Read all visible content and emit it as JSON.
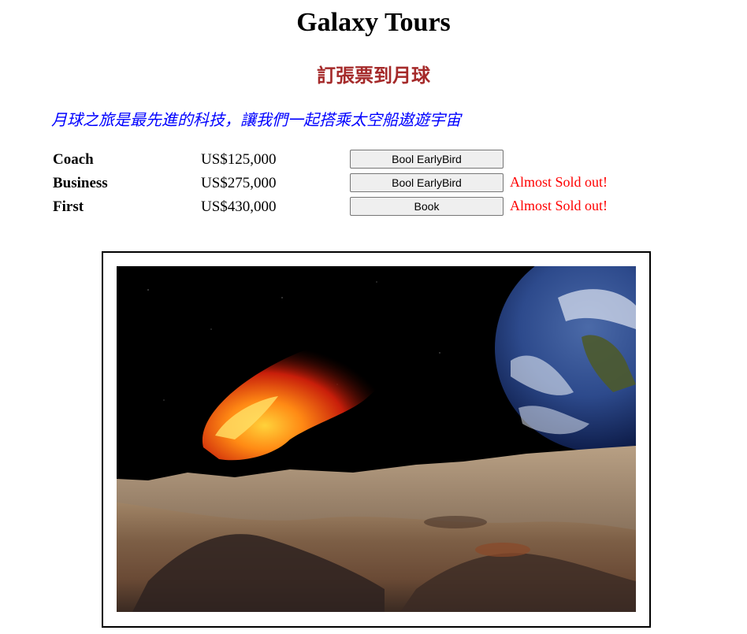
{
  "header": {
    "title": "Galaxy Tours",
    "subtitle": "訂張票到月球",
    "tagline": "月球之旅是最先進的科技，讓我們一起搭乘太空船遨遊宇宙"
  },
  "fares": [
    {
      "class": "Coach",
      "price": "US$125,000",
      "button": "Bool EarlyBird",
      "alert": ""
    },
    {
      "class": "Business",
      "price": "US$275,000",
      "button": "Bool EarlyBird",
      "alert": "Almost Sold out!"
    },
    {
      "class": "First",
      "price": "US$430,000",
      "button": "Book",
      "alert": "Almost Sold out!"
    }
  ],
  "colors": {
    "subtitle": "#a52a2a",
    "tagline": "#0000ff",
    "alert": "#ff0000"
  }
}
